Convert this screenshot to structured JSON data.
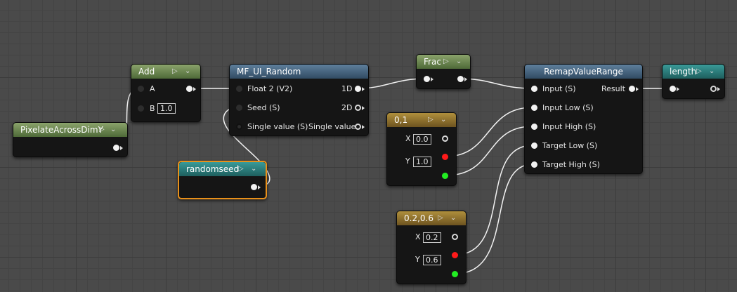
{
  "nodes": {
    "pixelate": {
      "title": "PixelateAcrossDimY"
    },
    "add": {
      "title": "Add",
      "pin_a": "A",
      "pin_b": "B",
      "b_value": "1.0"
    },
    "mf_random": {
      "title": "MF_UI_Random",
      "in_float2": "Float 2 (V2)",
      "in_seed": "Seed (S)",
      "in_single": "Single value (S)",
      "out_1d": "1D",
      "out_2d": "2D",
      "out_single": "Single value"
    },
    "randomseed": {
      "title": "randomseed"
    },
    "frac": {
      "title": "Frac"
    },
    "const01": {
      "title": "0,1",
      "x_label": "X",
      "x_value": "0.0",
      "y_label": "Y",
      "y_value": "1.0"
    },
    "const0206": {
      "title": "0.2,0.6",
      "x_label": "X",
      "x_value": "0.2",
      "y_label": "Y",
      "y_value": "0.6"
    },
    "remap": {
      "title": "RemapValueRange",
      "input": "Input (S)",
      "input_low": "Input Low (S)",
      "input_high": "Input High (S)",
      "target_low": "Target Low (S)",
      "target_high": "Target High (S)",
      "result": "Result"
    },
    "length": {
      "title": "length"
    }
  },
  "icons": {
    "preview": "preview-toggle-icon",
    "collapse": "chevron-down-icon"
  },
  "colors": {
    "canvas": "#4a4a4a",
    "selected_outline": "#e8901a",
    "wire": "#f0f0f0",
    "pin_red": "#ff1a1a",
    "pin_green": "#22ee22"
  }
}
